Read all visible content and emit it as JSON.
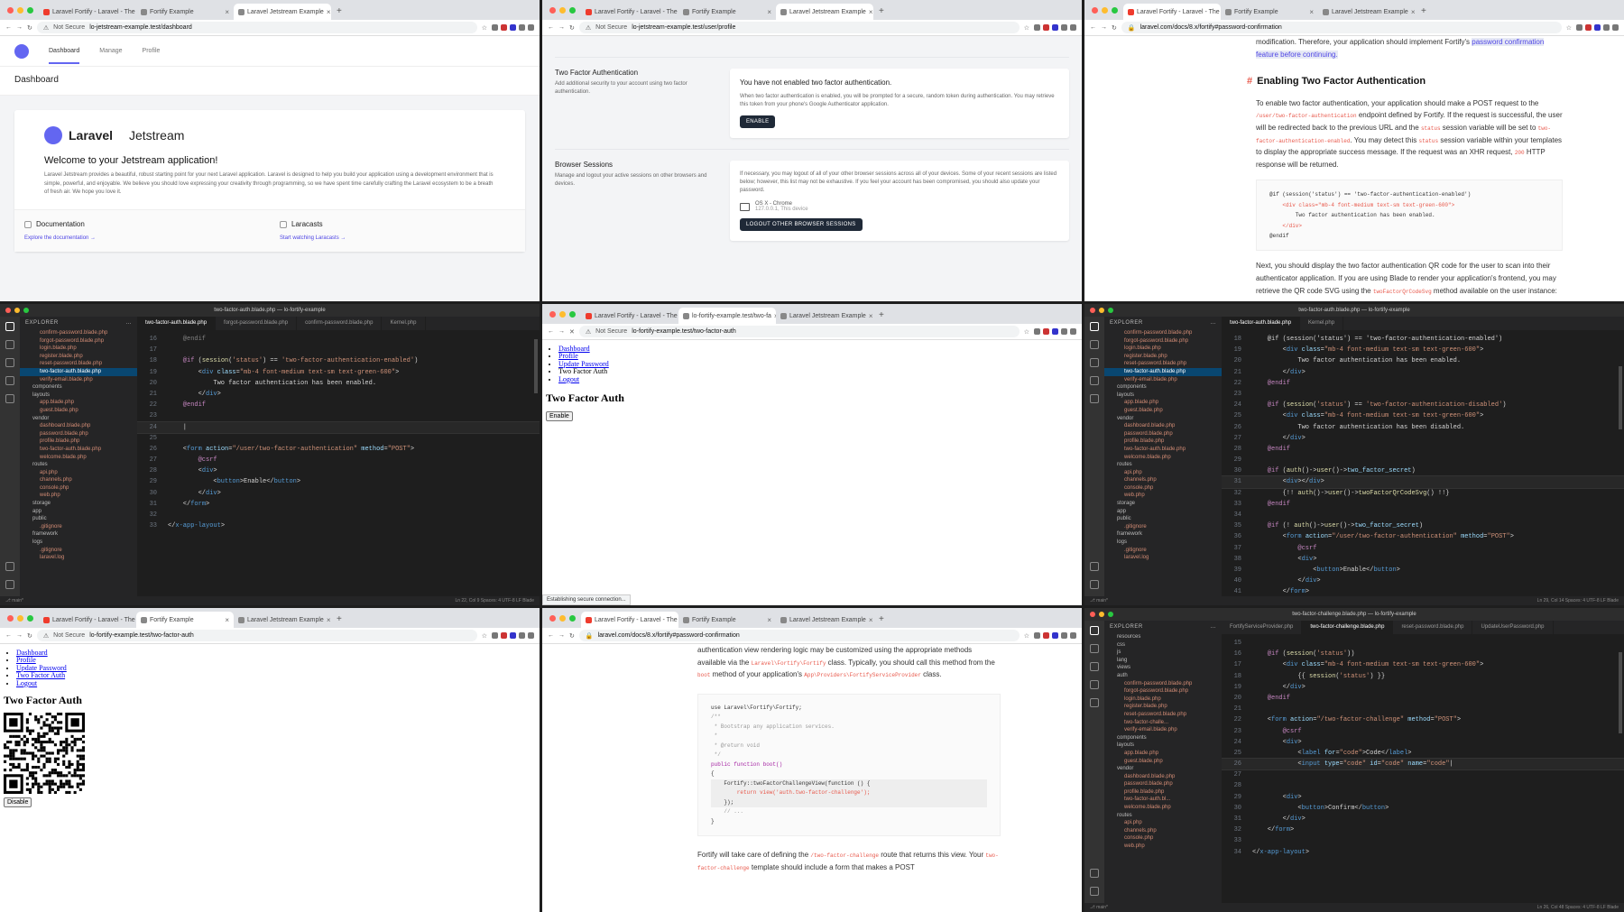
{
  "p0": {
    "tabs": [
      "Laravel Fortify - Laravel - The",
      "Fortify Example",
      "Laravel Jetstream Example"
    ],
    "url_secure": "Not Secure",
    "url": "lo-jetstream-example.test/dashboard",
    "nav": [
      "Dashboard",
      "Manage",
      "Profile"
    ],
    "header": "Dashboard",
    "brand_a": "Laravel",
    "brand_b": "Jetstream",
    "welcome": "Welcome to your Jetstream application!",
    "intro": "Laravel Jetstream provides a beautiful, robust starting point for your next Laravel application. Laravel is designed to help you build your application using a development environment that is simple, powerful, and enjoyable. We believe you should love expressing your creativity through programming, so we have spent time carefully crafting the Laravel ecosystem to be a breath of fresh air. We hope you love it.",
    "cards": [
      {
        "title": "Documentation",
        "text": "",
        "link": "Explore the documentation →"
      },
      {
        "title": "Laracasts",
        "text": "",
        "link": "Start watching Laracasts →"
      }
    ],
    "status": ""
  },
  "p1": {
    "tabs": [
      "Laravel Fortify - Laravel - The",
      "Fortify Example",
      "Laravel Jetstream Example"
    ],
    "url_secure": "Not Secure",
    "url": "lo-jetstream-example.test/user/profile",
    "twofa_title": "Two Factor Authentication",
    "twofa_desc": "Add additional security to your account using two factor authentication.",
    "twofa_head": "You have not enabled two factor authentication.",
    "twofa_text": "When two factor authentication is enabled, you will be prompted for a secure, random token during authentication. You may retrieve this token from your phone's Google Authenticator application.",
    "enable": "ENABLE",
    "sess_title": "Browser Sessions",
    "sess_desc": "Manage and logout your active sessions on other browsers and devices.",
    "sess_text": "If necessary, you may logout of all of your other browser sessions across all of your devices. Some of your recent sessions are listed below; however, this list may not be exhaustive. If you feel your account has been compromised, you should also update your password.",
    "sess_device": "OS X - Chrome",
    "sess_meta": "127.0.0.1, This device",
    "logout": "LOGOUT OTHER BROWSER SESSIONS"
  },
  "p2": {
    "tabs": [
      "Laravel Fortify - Laravel - The",
      "Fortify Example",
      "Laravel Jetstream Example"
    ],
    "url": "laravel.com/docs/8.x/fortify#password-confirmation",
    "top_a": "modification. Therefore, your application should implement Fortify's",
    "top_link": "password confirmation",
    "top_b": "feature before continuing.",
    "heading": "Enabling Two Factor Authentication",
    "para1_a": "To enable two factor authentication, your application should make a POST request to the",
    "para1_code1": "/user/two-factor-authentication",
    "para1_b": "endpoint defined by Fortify. If the request is successful, the user will be redirected back to the previous URL and the",
    "para1_code2": "status",
    "para1_c": "session variable will be set to",
    "para1_code3": "two-factor-authentication-enabled",
    "para1_d": ". You may detect this",
    "para1_code4": "status",
    "para1_e": "session variable within your templates to display the appropriate success message. If the request was an XHR request,",
    "para1_code5": "200",
    "para1_f": "HTTP response will be returned.",
    "code": [
      "@if (session('status') == 'two-factor-authentication-enabled')",
      "    <div class=\"mb-4 font-medium text-sm text-green-600\">",
      "        Two factor authentication has been enabled.",
      "    </div>",
      "@endif"
    ],
    "para2_a": "Next, you should display the two factor authentication QR code for the user to scan into their authenticator application. If you are using Blade to render your application's frontend, you may retrieve the QR code SVG using the",
    "para2_code": "twoFactorQrCodeSvg",
    "para2_b": "method available on the user instance:"
  },
  "p3": {
    "title": "two-factor-auth.blade.php — lo-fortify-example",
    "tabs": [
      "two-factor-auth.blade.php",
      "forgot-password.blade.php",
      "confirm-password.blade.php",
      "Kernel.php"
    ],
    "sidebar_head": "EXPLORER",
    "files": [
      "confirm-password.blade.php",
      "forgot-password.blade.php",
      "login.blade.php",
      "register.blade.php",
      "reset-password.blade.php",
      "two-factor-auth.blade.php",
      "verify-email.blade.php",
      "components",
      "layouts",
      "app.blade.php",
      "guest.blade.php",
      "vendor",
      "dashboard.blade.php",
      "password.blade.php",
      "profile.blade.php",
      "two-factor-auth.blade.php",
      "welcome.blade.php",
      "routes",
      "api.php",
      "channels.php",
      "console.php",
      "web.php",
      "storage",
      "app",
      "public",
      ".gitignore",
      "framework",
      "logs",
      ".gitignore",
      "laravel.log"
    ],
    "status_left": "⎇ main*",
    "status_right": "Ln 22, Col 9   Spaces: 4   UTF-8   LF   Blade"
  },
  "p4": {
    "tabs": [
      "Laravel Fortify - Laravel - The",
      "lo-fortify-example.test/two-fa",
      "Laravel Jetstream Example"
    ],
    "url_secure": "Not Secure",
    "url": "lo-fortify-example.test/two-factor-auth",
    "links": [
      "Dashboard",
      "Profile",
      "Update Password",
      "Two Factor Auth",
      "Logout"
    ],
    "heading": "Two Factor Auth",
    "button": "Enable",
    "status": "Establishing secure connection..."
  },
  "p5": {
    "title": "two-factor-auth.blade.php — lo-fortify-example",
    "tabs": [
      "two-factor-auth.blade.php",
      "Kernel.php"
    ],
    "sidebar_head": "EXPLORER",
    "files": [
      "confirm-password.blade.php",
      "forgot-password.blade.php",
      "login.blade.php",
      "register.blade.php",
      "reset-password.blade.php",
      "two-factor-auth.blade.php",
      "verify-email.blade.php",
      "components",
      "layouts",
      "app.blade.php",
      "guest.blade.php",
      "vendor",
      "dashboard.blade.php",
      "password.blade.php",
      "profile.blade.php",
      "two-factor-auth.blade.php",
      "welcome.blade.php",
      "routes",
      "api.php",
      "channels.php",
      "console.php",
      "web.php",
      "storage",
      "app",
      "public",
      ".gitignore",
      "framework",
      "logs",
      ".gitignore",
      "laravel.log"
    ],
    "status_left": "⎇ main*",
    "status_right": "Ln 29, Col 14   Spaces: 4   UTF-8   LF   Blade"
  },
  "p6": {
    "tabs": [
      "Laravel Fortify - Laravel - The",
      "Fortify Example",
      "Laravel Jetstream Example"
    ],
    "url_secure": "Not Secure",
    "url": "lo-fortify-example.test/two-factor-auth",
    "links": [
      "Dashboard",
      "Profile",
      "Update Password",
      "Two Factor Auth",
      "Logout"
    ],
    "heading": "Two Factor Auth",
    "codes": [],
    "button": "Disable"
  },
  "p7": {
    "tabs": [
      "Laravel Fortify - Laravel - The",
      "Fortify Example",
      "Laravel Jetstream Example"
    ],
    "url": "laravel.com/docs/8.x/fortify#password-confirmation",
    "para1_a": "authentication view rendering logic may be customized using the appropriate methods available via the",
    "para1_code": "Laravel\\Fortify\\Fortify",
    "para1_b": "class. Typically, you should call this method from the",
    "para1_code2": "boot",
    "para1_c": "method of your application's",
    "para1_code3": "App\\Providers\\FortifyServiceProvider",
    "para1_d": "class.",
    "code": [
      "use Laravel\\Fortify\\Fortify;",
      "",
      "/**",
      " * Bootstrap any application services.",
      " *",
      " * @return void",
      " */",
      "public function boot()",
      "{",
      "    Fortify::twoFactorChallengeView(function () {",
      "        return view('auth.two-factor-challenge');",
      "    });",
      "",
      "    // ...",
      "}"
    ],
    "para2_a": "Fortify will take care of defining the",
    "para2_code": "/two-factor-challenge",
    "para2_b": "route that returns this view. Your",
    "para2_code2": "two-factor-challenge",
    "para2_c": "template should include a form that makes a POST"
  },
  "p8": {
    "title": "two-factor-challenge.blade.php — lo-fortify-example",
    "tabs": [
      "FortifyServiceProvider.php",
      "two-factor-challenge.blade.php",
      "reset-password.blade.php",
      "UpdateUserPassword.php"
    ],
    "sidebar_head": "EXPLORER",
    "files": [
      "resources",
      "css",
      "js",
      "lang",
      "views",
      "auth",
      "confirm-password.blade.php",
      "forgot-password.blade.php",
      "login.blade.php",
      "register.blade.php",
      "reset-password.blade.php",
      "two-factor-challe...",
      "verify-email.blade.php",
      "components",
      "layouts",
      "app.blade.php",
      "guest.blade.php",
      "vendor",
      "dashboard.blade.php",
      "password.blade.php",
      "profile.blade.php",
      "two-factor-auth.bl...",
      "welcome.blade.php",
      "routes",
      "api.php",
      "channels.php",
      "console.php",
      "web.php"
    ],
    "status_left": "⎇ main*",
    "status_right": "Ln 26, Col 48   Spaces: 4   UTF-8   LF   Blade"
  },
  "colors": {
    "accent": "#6366f1",
    "vscode_bg": "#1e1e1e",
    "dark_button": "#1f2937"
  },
  "icons": [
    "search-icon",
    "files-icon",
    "git-icon",
    "debug-icon",
    "extensions-icon",
    "gear-icon",
    "account-icon"
  ]
}
